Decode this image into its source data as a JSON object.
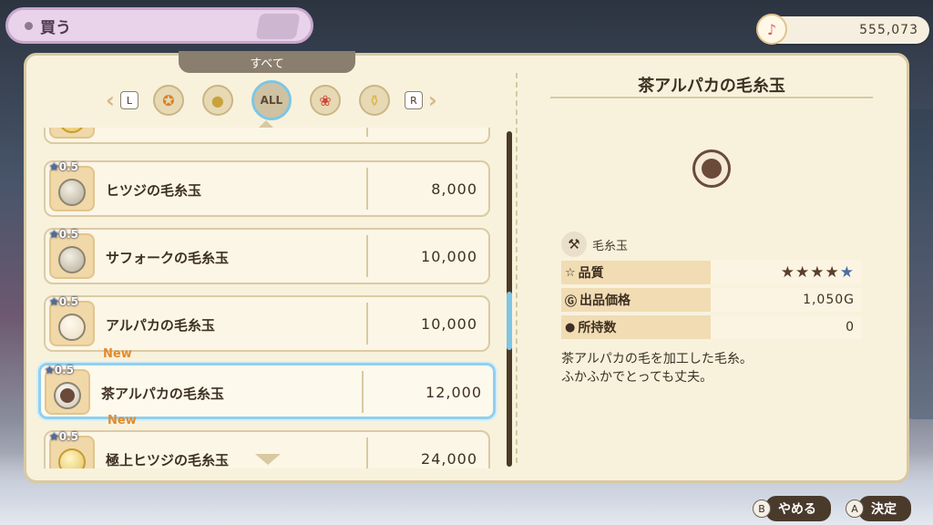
{
  "header": {
    "title": "買う",
    "money": "555,073"
  },
  "category_bar": {
    "current": "すべて",
    "left_key": "L",
    "right_key": "R",
    "icons": [
      {
        "name": "star-coin-icon",
        "glyph": "✪"
      },
      {
        "name": "coin-icon",
        "glyph": "●"
      },
      {
        "name": "all-category",
        "glyph": "ALL"
      },
      {
        "name": "bag-icon",
        "glyph": "❀"
      },
      {
        "name": "bottle-icon",
        "glyph": "⚱"
      }
    ]
  },
  "list": {
    "items": [
      {
        "rating": "0.5",
        "name": "ヒツジの毛糸玉",
        "price": "8,000",
        "new": ""
      },
      {
        "rating": "0.5",
        "name": "サフォークの毛糸玉",
        "price": "10,000",
        "new": ""
      },
      {
        "rating": "0.5",
        "name": "アルパカの毛糸玉",
        "price": "10,000",
        "new": ""
      },
      {
        "rating": "0.5",
        "name": "茶アルパカの毛糸玉",
        "price": "12,000",
        "new": "New"
      },
      {
        "rating": "0.5",
        "name": "極上ヒツジの毛糸玉",
        "price": "24,000",
        "new": "New"
      }
    ],
    "selected_index": 3
  },
  "detail": {
    "title": "茶アルパカの毛糸玉",
    "category": "毛糸玉",
    "quality_label": "品質",
    "quality_stars": 4.5,
    "price_label": "出品価格",
    "price_value": "1,050G",
    "owned_label": "所持数",
    "owned_value": "0",
    "description_line1": "茶アルパカの毛を加工した毛糸。",
    "description_line2": "ふかふかでとっても丈夫。"
  },
  "footer": {
    "cancel_key": "B",
    "cancel_label": "やめる",
    "confirm_key": "A",
    "confirm_label": "決定"
  },
  "colors": {
    "accent": "#7ec6e3",
    "panel": "#f8f2dd",
    "new": "#e48a2c"
  }
}
